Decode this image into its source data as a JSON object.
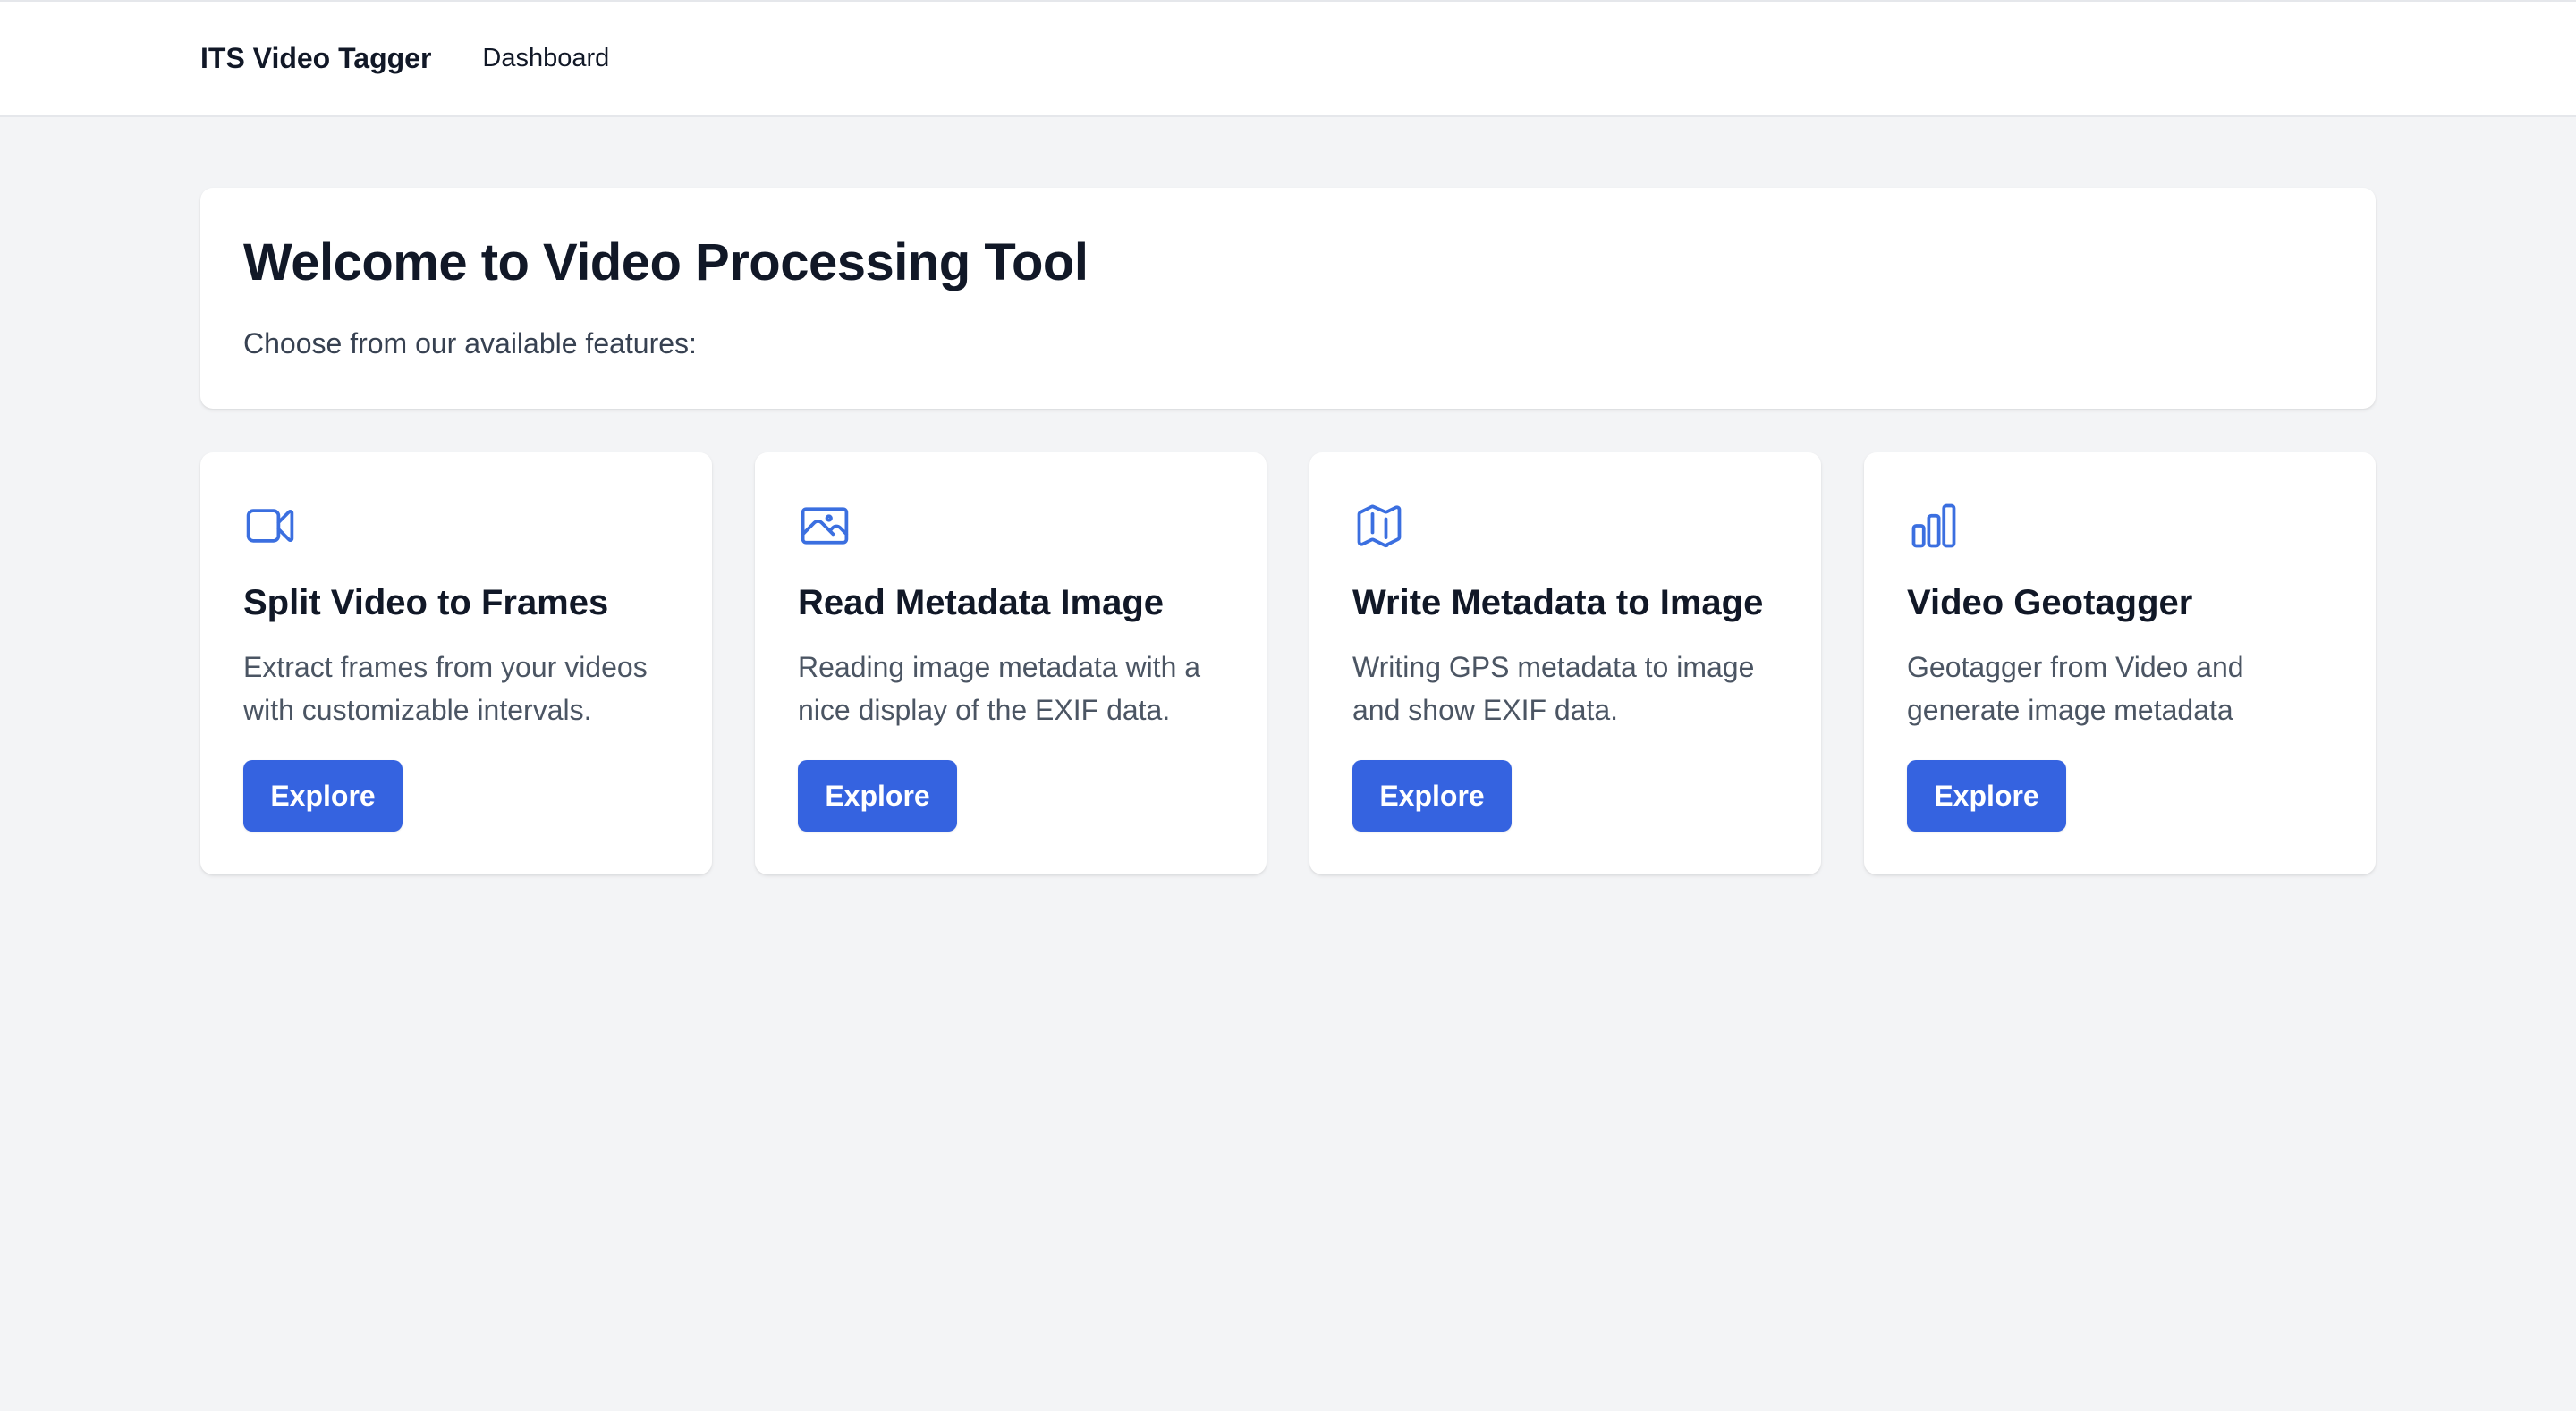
{
  "nav": {
    "brand": "ITS Video Tagger",
    "links": [
      "Dashboard"
    ]
  },
  "welcome": {
    "title": "Welcome to Video Processing Tool",
    "subtitle": "Choose from our available features:"
  },
  "colors": {
    "accent": "#3563e0",
    "icon": "#3b6fe0",
    "background": "#f3f4f6"
  },
  "cards": [
    {
      "icon": "video-camera-icon",
      "title": "Split Video to Frames",
      "description": "Extract frames from your videos with customizable intervals.",
      "button": "Explore"
    },
    {
      "icon": "image-icon",
      "title": "Read Metadata Image",
      "description": "Reading image metadata with a nice display of the EXIF data.",
      "button": "Explore"
    },
    {
      "icon": "map-icon",
      "title": "Write Metadata to Image",
      "description": "Writing GPS metadata to image and show EXIF data.",
      "button": "Explore"
    },
    {
      "icon": "bar-chart-icon",
      "title": "Video Geotagger",
      "description": "Geotagger from Video and generate image metadata",
      "button": "Explore"
    }
  ]
}
